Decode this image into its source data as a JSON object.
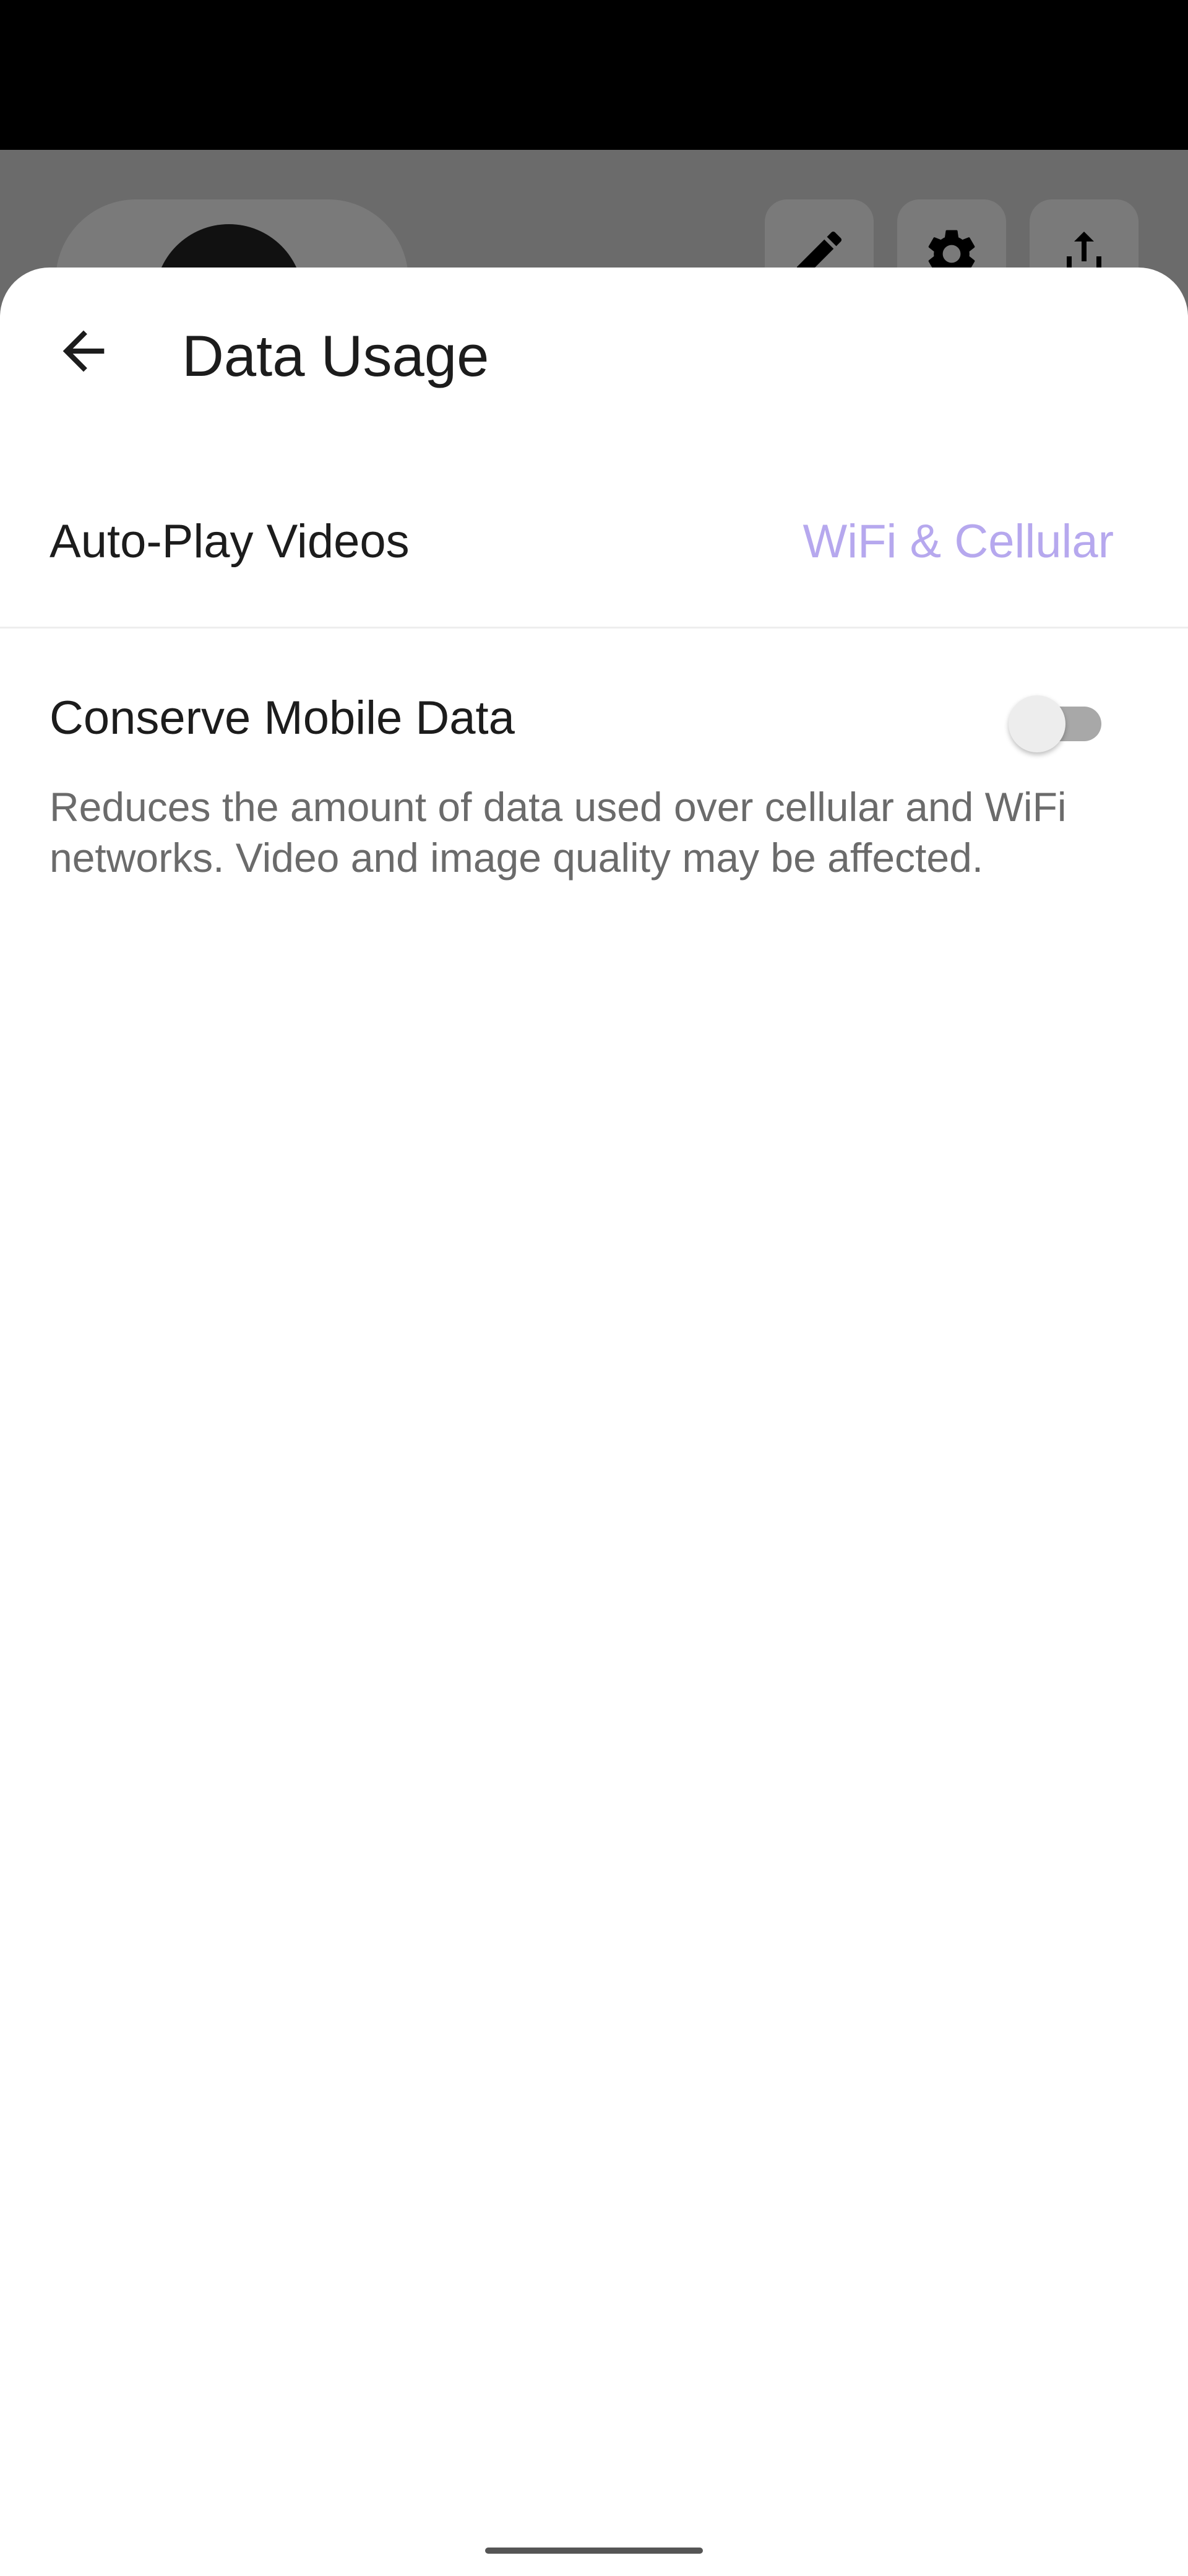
{
  "header": {
    "title": "Data Usage",
    "back_icon": "arrow-back-icon"
  },
  "settings": {
    "autoplay": {
      "label": "Auto-Play Videos",
      "value": "WiFi & Cellular"
    },
    "conserve": {
      "label": "Conserve Mobile Data",
      "enabled": false,
      "description": "Reduces the amount of data used over cellular and WiFi networks. Video and image quality may be affected."
    }
  },
  "backdrop_icons": [
    "pencil-icon",
    "gear-icon",
    "share-icon"
  ],
  "colors": {
    "accent_value": "#b6a8ee",
    "title_text": "#1c1c1c",
    "secondary_text": "#6b6b6b",
    "toggle_off_track": "#a8a8a8",
    "toggle_off_knob": "#ededed",
    "scrim": "#6b6b6b"
  }
}
